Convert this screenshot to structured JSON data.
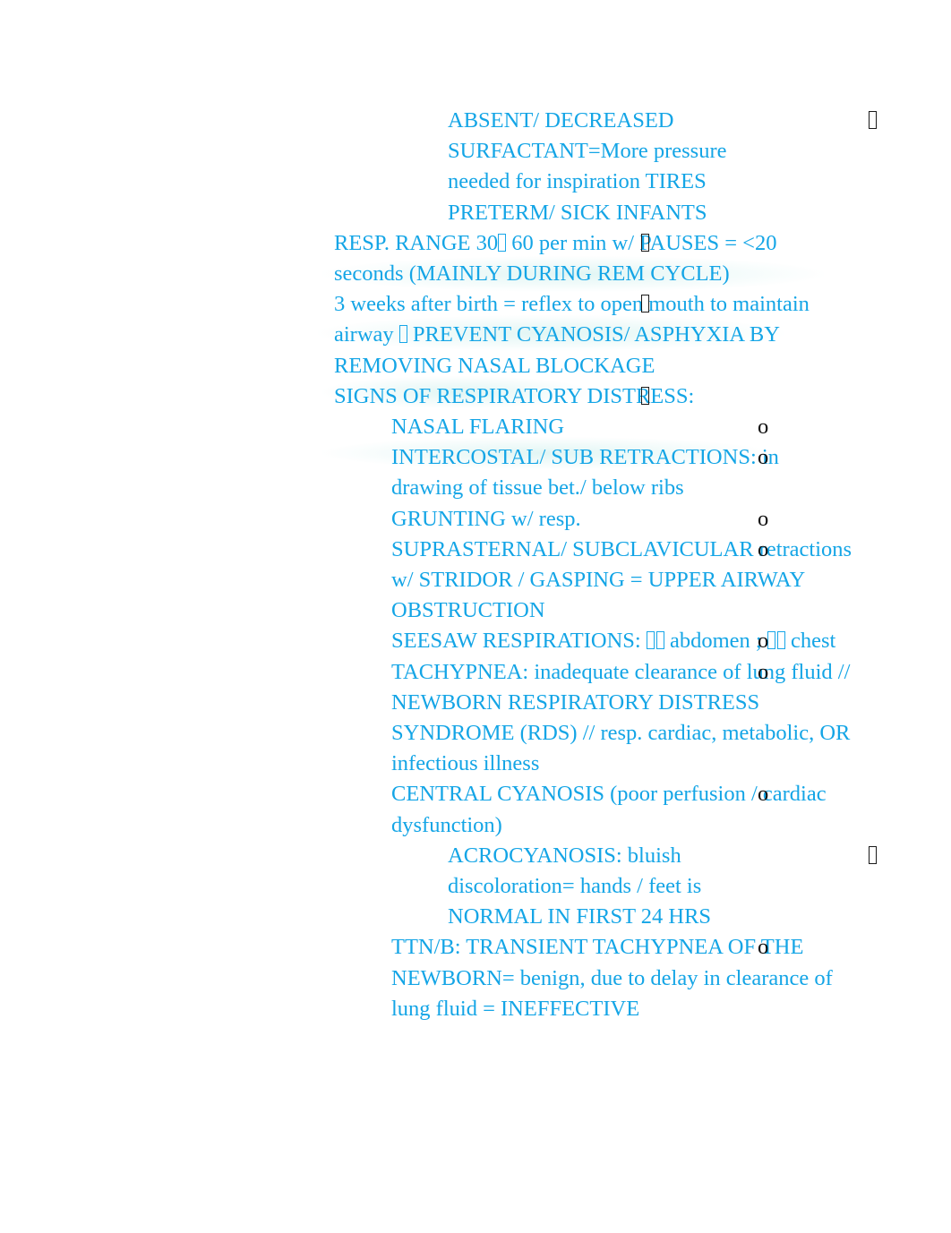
{
  "document": {
    "text_color": "#14A5E6",
    "marker_color": "#111111",
    "background": "#ffffff",
    "blocks": [
      {
        "id": "absent-surfactant",
        "level": 3,
        "marker": "missing-glyph-box",
        "text": "ABSENT/ DECREASED SURFACTANT=More pressure needed for inspiration TIRES PRETERM/ SICK INFANTS"
      },
      {
        "id": "resp-range",
        "level": 1,
        "marker": "missing-glyph-box",
        "text_before": "RESP. RANGE 30",
        "inline_glyph": "missing-glyph-box-cyan",
        "text_after": " 60 per min w/ PAUSES = <20 seconds (MAINLY DURING REM CYCLE)"
      },
      {
        "id": "three-weeks-reflex",
        "level": 1,
        "marker": "missing-glyph-box",
        "text_before": "3 weeks after birth = reflex to open mouth to maintain airway ",
        "inline_glyph": "missing-glyph-box-cyan",
        "text_after": "  PREVENT CYANOSIS/ ASPHYXIA BY REMOVING NASAL BLOCKAGE"
      },
      {
        "id": "signs-of-respiratory-distress",
        "level": 1,
        "marker": "missing-glyph-box",
        "text": "SIGNS OF RESPIRATORY DISTRESS:"
      },
      {
        "id": "nasal-flaring",
        "level": 2,
        "marker": "o",
        "text": "NASAL FLARING"
      },
      {
        "id": "intercostal-retractions",
        "level": 2,
        "marker": "o",
        "text": "INTERCOSTAL/ SUB RETRACTIONS: in drawing of tissue bet./ below ribs"
      },
      {
        "id": "grunting",
        "level": 2,
        "marker": "o",
        "text": "GRUNTING w/ resp."
      },
      {
        "id": "suprasternal-subclavicular",
        "level": 2,
        "marker": "o",
        "text": "SUPRASTERNAL/ SUBCLAVICULAR retractions w/ STRIDOR / GASPING = UPPER AIRWAY OBSTRUCTION"
      },
      {
        "id": "seesaw-respirations",
        "level": 2,
        "marker": "o",
        "text_before": "SEESAW RESPIRATIONS: ",
        "inline_glyph_1": "missing-glyph-box-pair-cyan",
        "text_middle": " abdomen ; ",
        "inline_glyph_2": "missing-glyph-box-pair-cyan",
        "text_after": "  chest"
      },
      {
        "id": "tachypnea",
        "level": 2,
        "marker": "o",
        "text": "TACHYPNEA: inadequate clearance of lung fluid // NEWBORN RESPIRATORY DISTRESS SYNDROME (RDS) // resp. cardiac, metabolic, OR infectious illness"
      },
      {
        "id": "central-cyanosis",
        "level": 2,
        "marker": "o",
        "text": "CENTRAL CYANOSIS (poor perfusion / cardiac dysfunction)"
      },
      {
        "id": "acrocyanosis",
        "level": 3,
        "marker": "missing-glyph-box",
        "text": "ACROCYANOSIS: bluish discoloration= hands / feet is NORMAL IN FIRST 24 HRS"
      },
      {
        "id": "ttn-b",
        "level": 2,
        "marker": "o",
        "text": "TTN/B: TRANSIENT TACHYPNEA OF THE NEWBORN= benign, due to delay in clearance of lung fluid = INEFFECTIVE"
      }
    ]
  }
}
